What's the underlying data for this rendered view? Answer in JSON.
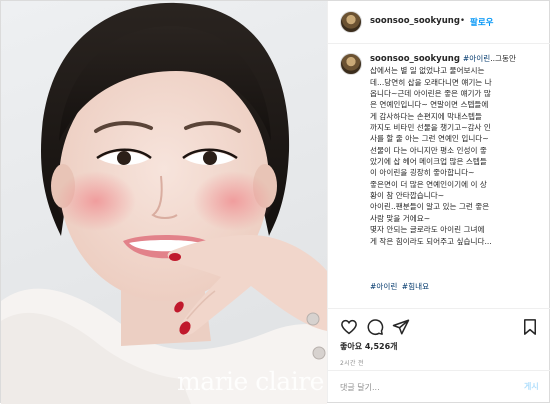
{
  "header": {
    "username": "soonsoo_sookyung",
    "separator": "•",
    "follow_label": "팔로우"
  },
  "photo": {
    "watermark": "marie claire"
  },
  "caption": {
    "username": "soonsoo_sookyung",
    "hashtag_inline": "#아이린",
    "lines": [
      "..그동안",
      "삽에서는 별 일 없었냐고 물어보시는",
      "데...당연히 삽을 오래다니면 얘기는 나",
      "옵니다~근데 아이린은 좋은 얘기가 많",
      "은 연예인입니다~ 연말이면 스텝들에",
      "게 감사하다는 손편지에 막내스텝들",
      "까지도 비타민 선물을 챙기고~감사 인",
      "사를 할 줄 아는 그런 연예인 입니다~",
      "선물이 다는 아니지만 평소 인성이 좋",
      "았기에 삽 헤어 메이크업 많은 스텝들",
      "이 아이린을 굉장히 좋아합니다~",
      "좋은면이 더 많은 연예인이기에 이 상",
      "황이 참 안타깝습니다~",
      "아이린..팬분들이 알고 있는 그런 좋은",
      "사람 맞을 거에요~",
      "몇자 안되는 글로라도 아이린 그녀에",
      "게 작은 힘이라도 되어주고 싶습니다..."
    ],
    "hashtags": [
      "#아이린",
      "#힘내요"
    ]
  },
  "actions": {
    "icons": [
      "heart-icon",
      "comment-icon",
      "share-icon",
      "bookmark-icon"
    ]
  },
  "likes": "좋아요 4,526개",
  "timestamp": "2시간 전",
  "comment": {
    "placeholder": "댓글 달기...",
    "post_label": "게시"
  },
  "colors": {
    "link_blue": "#0095f6",
    "hashtag": "#00376b",
    "border": "#dbdbdb",
    "muted": "#8e8e8e"
  }
}
